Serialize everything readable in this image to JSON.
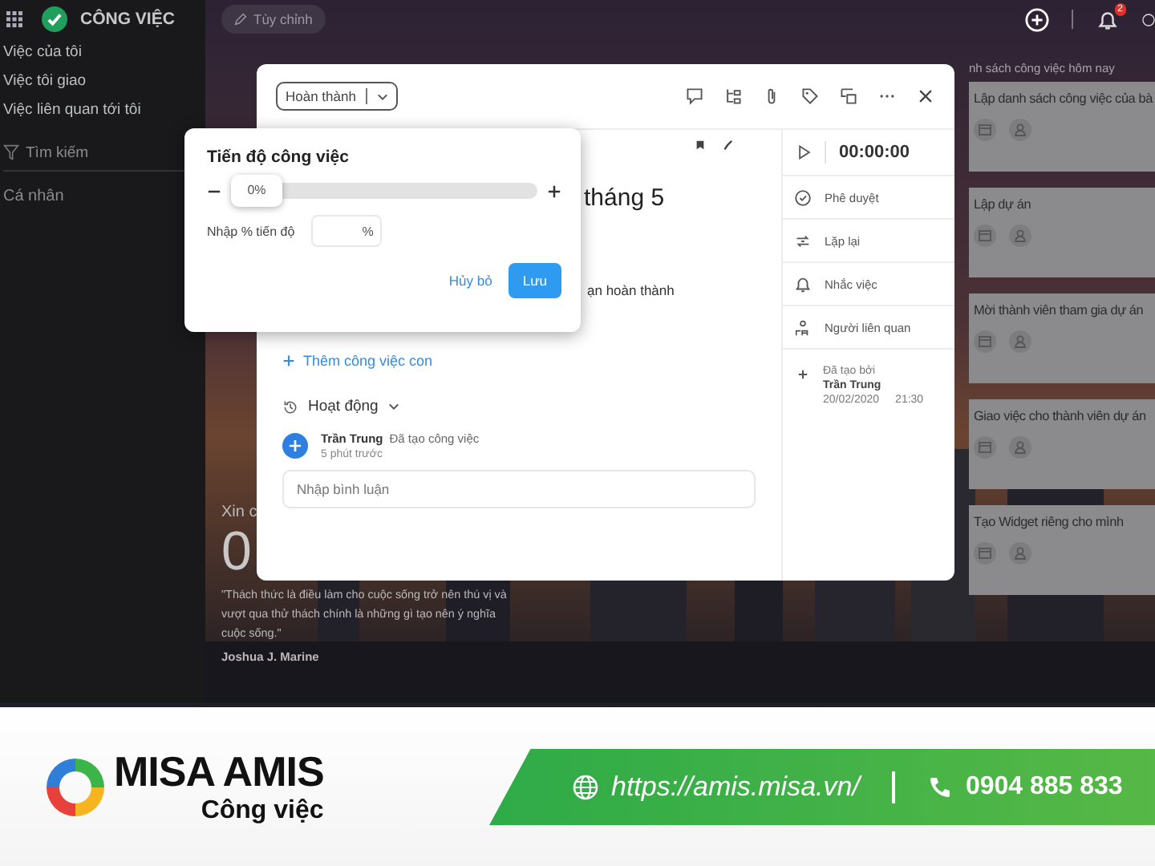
{
  "sidebar": {
    "app_title": "CÔNG VIỆC",
    "items": [
      {
        "label": "Việc của tôi"
      },
      {
        "label": "Việc tôi giao"
      },
      {
        "label": "Việc liên quan tới tôi"
      }
    ],
    "search": {
      "placeholder": "Tìm kiếm"
    },
    "section": "Cá nhân"
  },
  "toolbar": {
    "customize_button": "Tùy chỉnh",
    "notification_badge": "2"
  },
  "today_list": {
    "title": "nh sách công việc hôm nay",
    "cards": [
      {
        "title": "Lập danh sách công việc của bà"
      },
      {
        "title": "Lập dự án"
      },
      {
        "title": "Mời thành viên tham gia dự án"
      },
      {
        "title": "Giao việc cho thành viên dự án"
      },
      {
        "title": "Tạo Widget riêng cho mình"
      }
    ]
  },
  "greeting": {
    "text": "Xin c",
    "clock": "0",
    "quote": "\"Thách thức là điều làm cho cuộc sống trở nên thú vị và vượt qua thử thách chính là những gì tạo nên ý nghĩa cuộc sống.\"",
    "author": "Joshua J. Marine"
  },
  "task_dialog": {
    "status": "Hoàn thành",
    "title": "tháng 5",
    "deadline_label": "ạn hoàn thành",
    "add_subtask": "Thêm công việc con",
    "activity_title": "Hoạt động",
    "activity": [
      {
        "user": "Trần Trung",
        "action": "Đã tạo công việc",
        "time": "5 phút trước"
      }
    ],
    "comment": {
      "placeholder": "Nhập bình luận"
    },
    "timer": "00:00:00",
    "side_items": [
      {
        "kind": "approve",
        "label": "Phê duyệt"
      },
      {
        "kind": "repeat",
        "label": "Lặp lại"
      },
      {
        "kind": "remind",
        "label": "Nhắc việc"
      },
      {
        "kind": "people",
        "label": "Người liên quan"
      }
    ],
    "created": {
      "label": "Đã tạo bởi",
      "user": "Trần Trung",
      "date": "20/02/2020",
      "time": "21:30"
    }
  },
  "progress_popover": {
    "title": "Tiến độ công việc",
    "level": 0,
    "reading": "0%",
    "input_label": "Nhập % tiến độ",
    "unit": "%",
    "cancel": "Hủy bỏ",
    "save": "Lưu"
  },
  "banner": {
    "brand": "MISA AMIS",
    "product": "Công việc",
    "url": "https://amis.misa.vn/",
    "phone": "0904 885 833"
  }
}
